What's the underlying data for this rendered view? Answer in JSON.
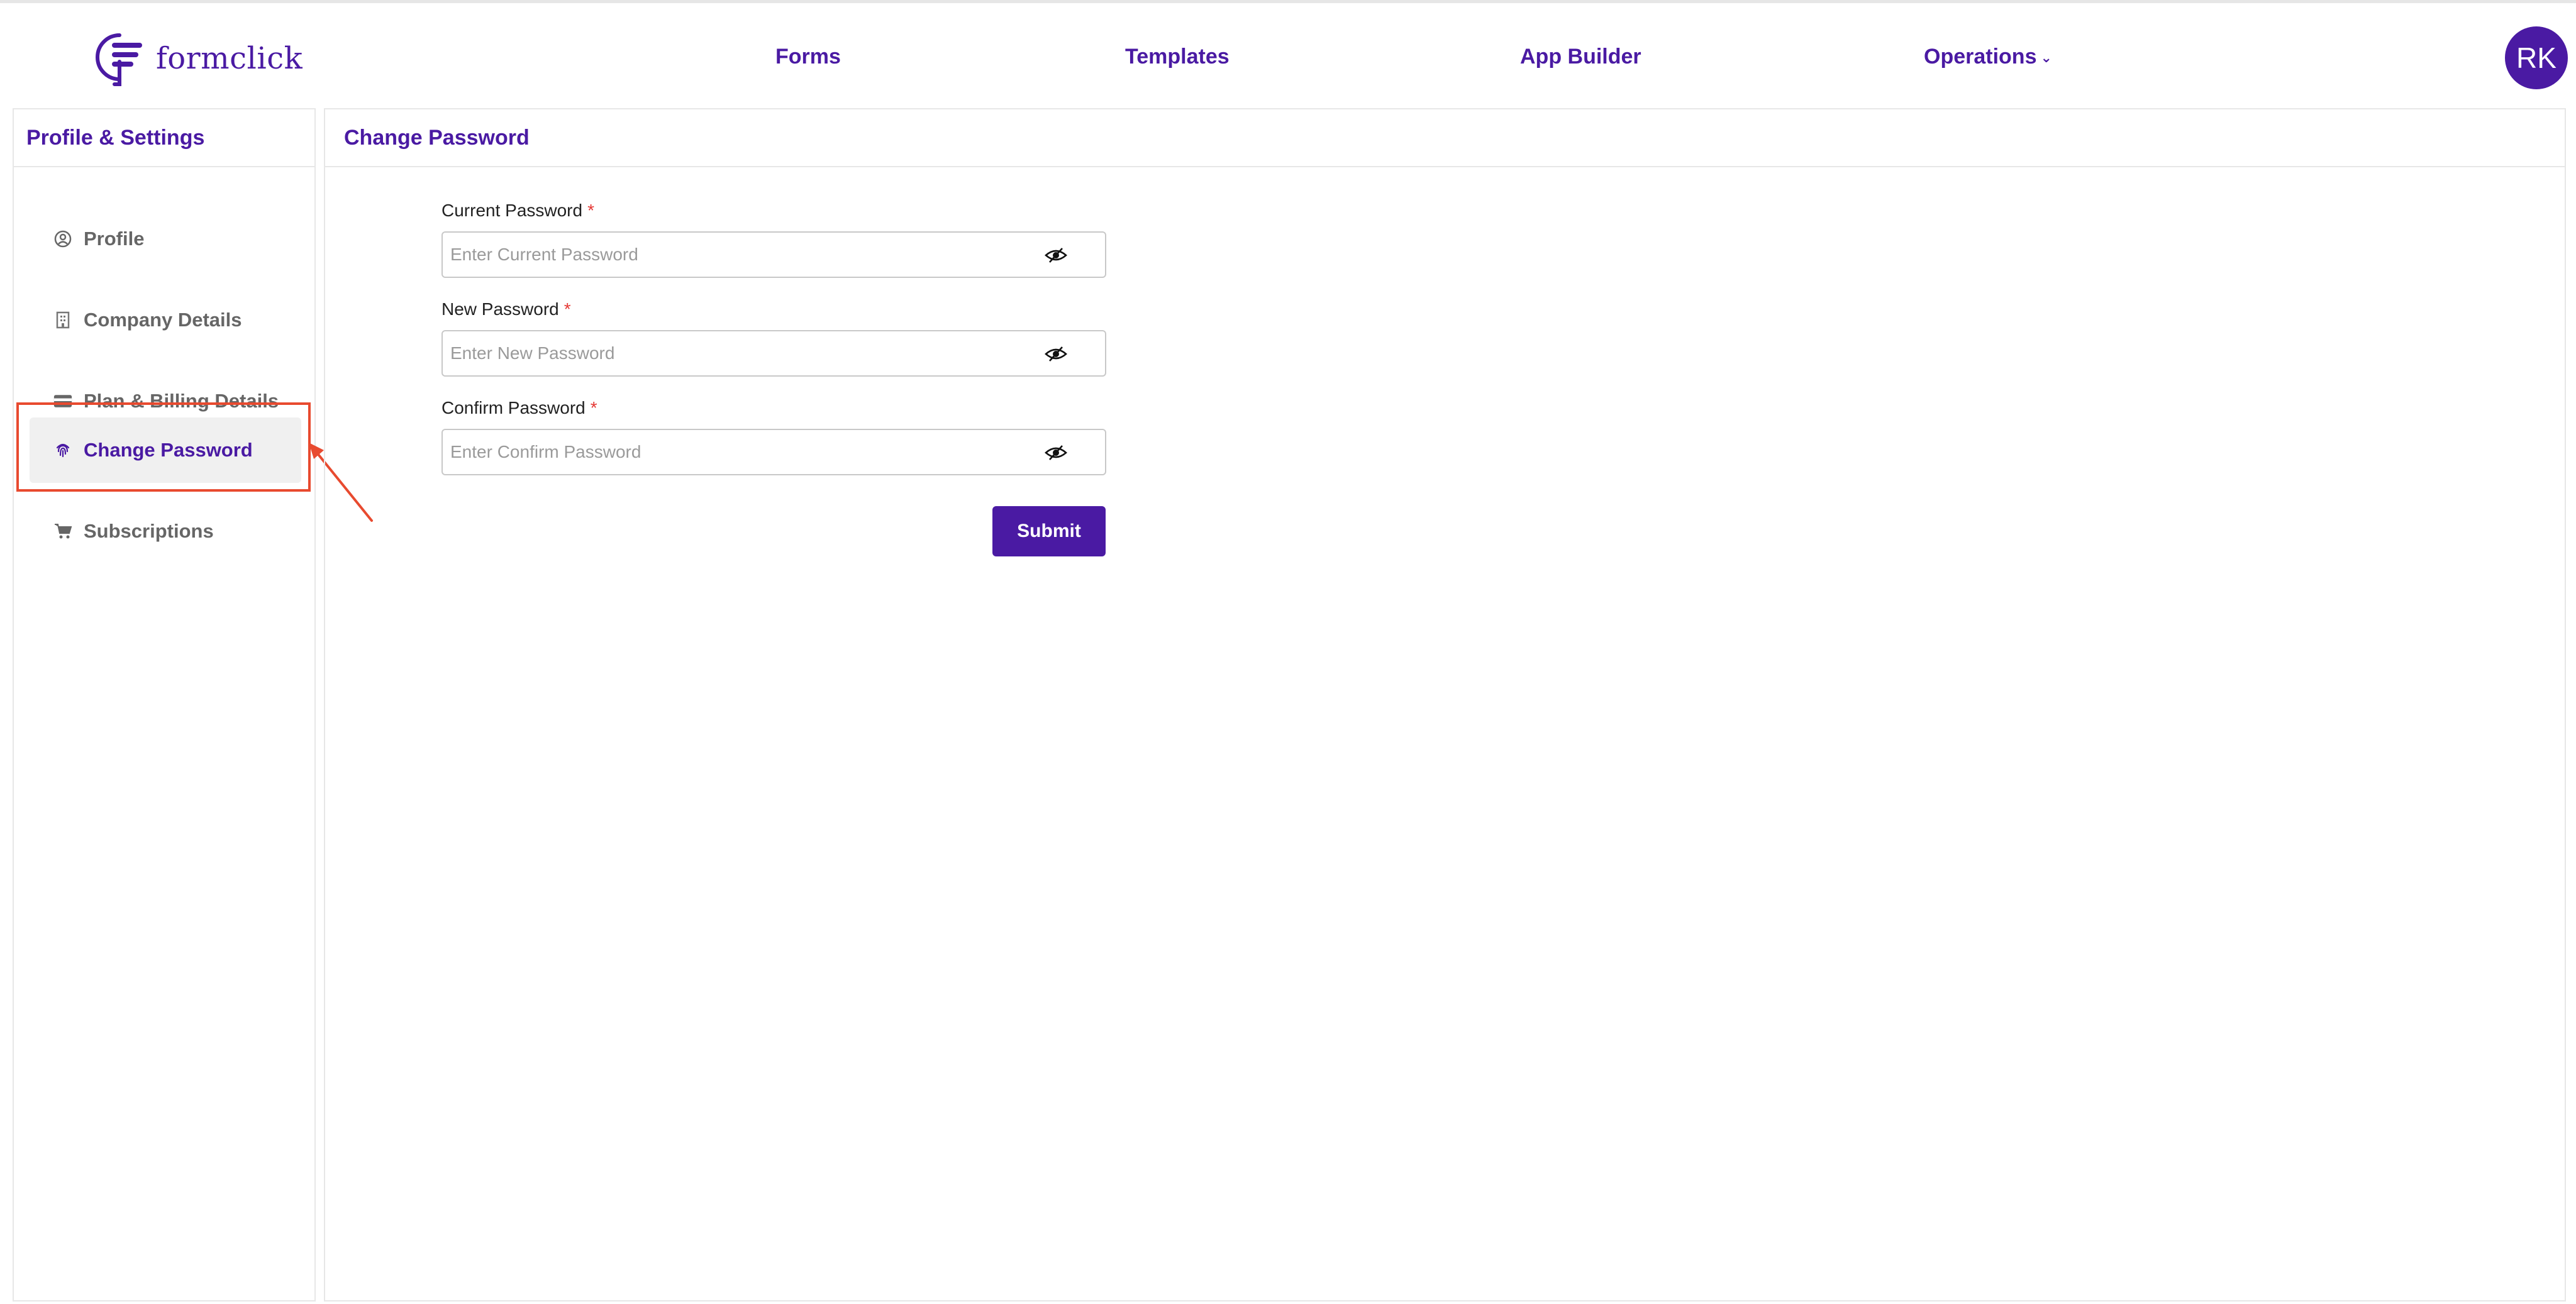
{
  "brand": {
    "name": "formclick",
    "primary_color": "#4a1aa3",
    "annotation_color": "#e84a2f"
  },
  "nav": {
    "forms": "Forms",
    "templates": "Templates",
    "app_builder": "App Builder",
    "operations": "Operations"
  },
  "user": {
    "initials": "RK"
  },
  "sidebar": {
    "title": "Profile & Settings",
    "items": [
      {
        "label": "Profile",
        "icon": "user-circle-icon"
      },
      {
        "label": "Company Details",
        "icon": "building-icon"
      },
      {
        "label": "Plan & Billing Details",
        "icon": "credit-card-icon"
      },
      {
        "label": "Change Password",
        "icon": "fingerprint-icon",
        "active": true
      },
      {
        "label": "Subscriptions",
        "icon": "cart-icon"
      }
    ]
  },
  "main": {
    "title": "Change Password",
    "fields": [
      {
        "label": "Current Password",
        "required": "*",
        "placeholder": "Enter Current Password"
      },
      {
        "label": "New Password",
        "required": "*",
        "placeholder": "Enter New Password"
      },
      {
        "label": "Confirm Password",
        "required": "*",
        "placeholder": "Enter Confirm Password"
      }
    ],
    "submit_label": "Submit"
  }
}
